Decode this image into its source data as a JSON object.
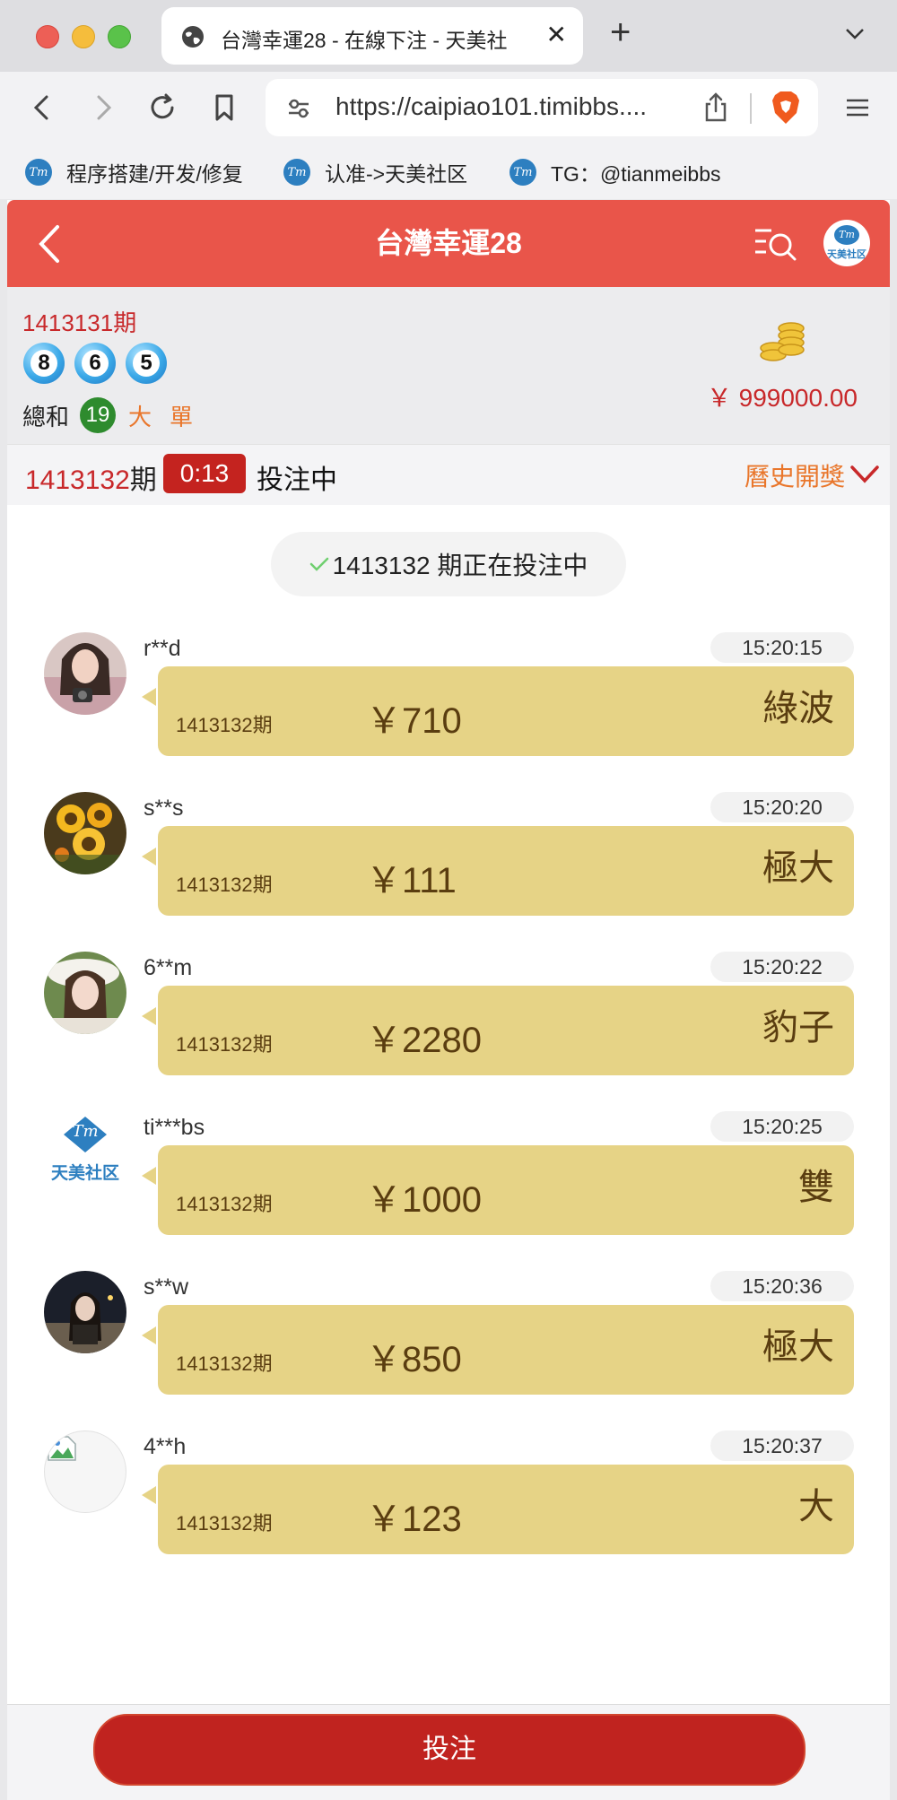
{
  "browser": {
    "tab_title": "台灣幸運28 - 在線下注 - 天美社",
    "url": "https://caipiao101.timibbs....",
    "bookmarks": [
      {
        "label": "程序搭建/开发/修复"
      },
      {
        "label": "认准->天美社区"
      },
      {
        "label": "TG：@tianmeibbs"
      }
    ]
  },
  "header": {
    "title": "台灣幸運28",
    "avatar_mark": "Tm",
    "avatar_text": "天美社区"
  },
  "result": {
    "period": "1413131期",
    "balls": [
      "8",
      "6",
      "5"
    ],
    "sum_label": "總和",
    "sum_value": "19",
    "size_tag": "大",
    "parity_tag": "單",
    "balance": "￥ 999000.00"
  },
  "betbar": {
    "period_number": "1413132",
    "period_suffix": "期",
    "countdown": "0:13",
    "status": "投注中",
    "history_label": "曆史開獎"
  },
  "notice": {
    "text": "1413132 期正在投注中"
  },
  "feed": [
    {
      "user": "r**d",
      "time": "15:20:15",
      "period": "1413132期",
      "amount": "￥710",
      "type": "綠波",
      "avatar": "photo-woman"
    },
    {
      "user": "s**s",
      "time": "15:20:20",
      "period": "1413132期",
      "amount": "￥111",
      "type": "極大",
      "avatar": "sunflowers"
    },
    {
      "user": "6**m",
      "time": "15:20:22",
      "period": "1413132期",
      "amount": "￥2280",
      "type": "豹子",
      "avatar": "photo-woman-hat"
    },
    {
      "user": "ti***bs",
      "time": "15:20:25",
      "period": "1413132期",
      "amount": "￥1000",
      "type": "雙",
      "avatar": "tianmei-logo"
    },
    {
      "user": "s**w",
      "time": "15:20:36",
      "period": "1413132期",
      "amount": "￥850",
      "type": "極大",
      "avatar": "photo-night"
    },
    {
      "user": "4**h",
      "time": "15:20:37",
      "period": "1413132期",
      "amount": "￥123",
      "type": "大",
      "avatar": "broken-image"
    }
  ],
  "feed_logo": {
    "mark": "Tm",
    "text": "天美社区"
  },
  "footer": {
    "bet_button": "投注"
  },
  "colors": {
    "header": "#e9554a",
    "accent_red": "#c8282a",
    "orange": "#e9762b",
    "bubble": "#e6d386",
    "button": "#c0231f"
  }
}
